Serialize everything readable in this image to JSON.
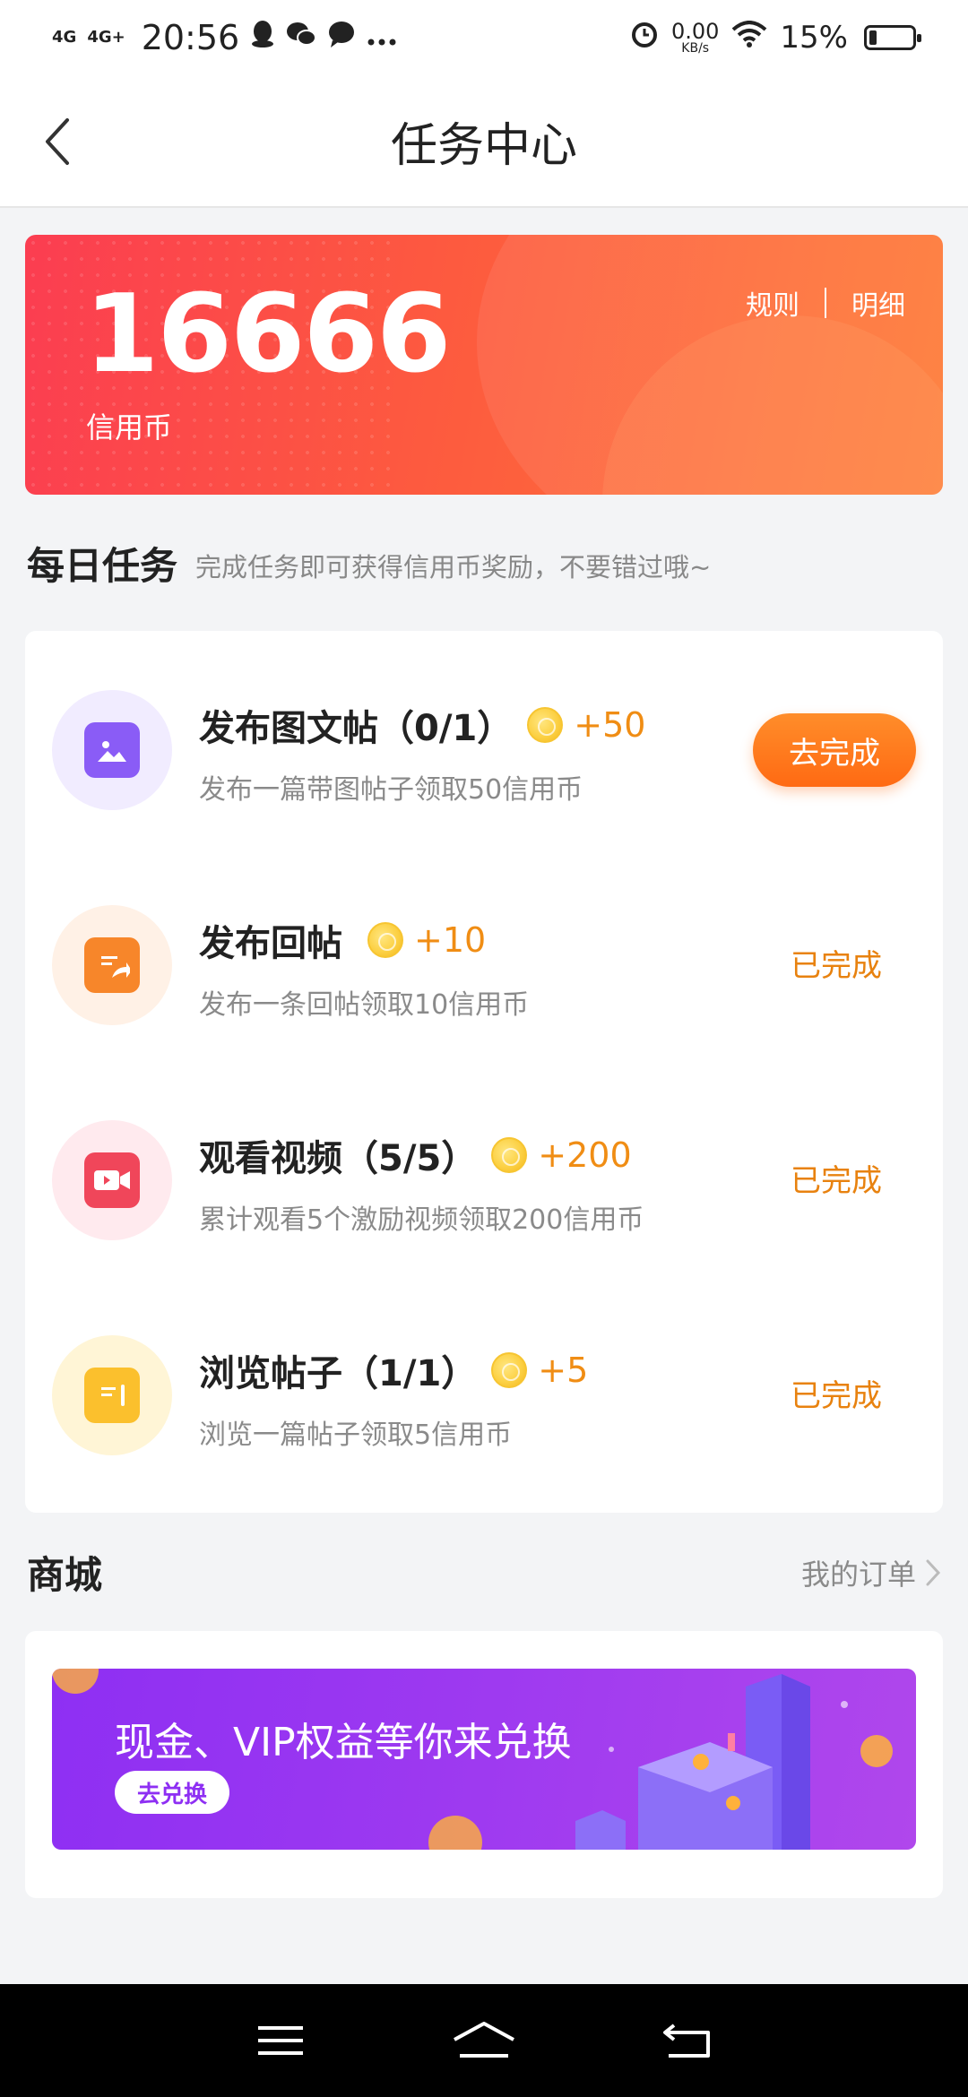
{
  "status_bar": {
    "network_1": "4G",
    "network_2": "4G+",
    "time": "20:56",
    "speed_value": "0.00",
    "speed_unit": "KB/s",
    "battery": "15%"
  },
  "header": {
    "title": "任务中心"
  },
  "credit": {
    "amount": "16666",
    "label": "信用币",
    "rules_link": "规则",
    "detail_link": "明细"
  },
  "daily": {
    "title": "每日任务",
    "subtitle": "完成任务即可获得信用币奖励，不要错过哦~",
    "tasks": [
      {
        "title": "发布图文帖（0/1）",
        "reward": "+50",
        "desc": "发布一篇带图帖子领取50信用币",
        "action": "去完成",
        "icon": "image-icon"
      },
      {
        "title": "发布回帖",
        "reward": "+10",
        "desc": "发布一条回帖领取10信用币",
        "action": "已完成",
        "icon": "reply-post-icon"
      },
      {
        "title": "观看视频（5/5）",
        "reward": "+200",
        "desc": "累计观看5个激励视频领取200信用币",
        "action": "已完成",
        "icon": "video-camera-icon"
      },
      {
        "title": "浏览帖子（1/1）",
        "reward": "+5",
        "desc": "浏览一篇帖子领取5信用币",
        "action": "已完成",
        "icon": "browse-post-icon"
      }
    ]
  },
  "mall": {
    "title": "商城",
    "orders_link": "我的订单",
    "banner_text": "现金、VIP权益等你来兑换",
    "banner_button": "去兑换"
  },
  "colors": {
    "accent_orange": "#ff6a13",
    "done_orange": "#e8820f",
    "banner_red": "#fb3d51",
    "banner_purple": "#8e2ff3"
  }
}
